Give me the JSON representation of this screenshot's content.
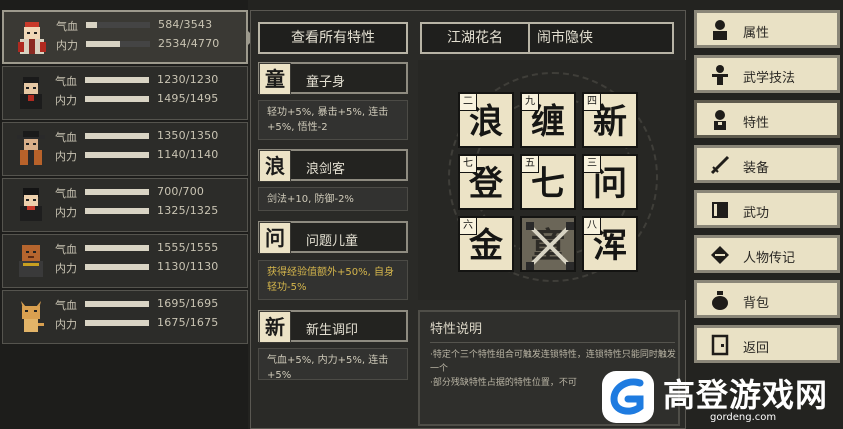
{
  "party": [
    {
      "hp_label": "气血",
      "mp_label": "内力",
      "hp": "584/3543",
      "mp": "2534/4770",
      "hp_frac": 0.165,
      "mp_frac": 0.531
    },
    {
      "hp_label": "气血",
      "mp_label": "内力",
      "hp": "1230/1230",
      "mp": "1495/1495",
      "hp_frac": 1.0,
      "mp_frac": 1.0
    },
    {
      "hp_label": "气血",
      "mp_label": "内力",
      "hp": "1350/1350",
      "mp": "1140/1140",
      "hp_frac": 1.0,
      "mp_frac": 1.0
    },
    {
      "hp_label": "气血",
      "mp_label": "内力",
      "hp": "700/700",
      "mp": "1325/1325",
      "hp_frac": 1.0,
      "mp_frac": 1.0
    },
    {
      "hp_label": "气血",
      "mp_label": "内力",
      "hp": "1555/1555",
      "mp": "1130/1130",
      "hp_frac": 1.0,
      "mp_frac": 1.0
    },
    {
      "hp_label": "气血",
      "mp_label": "内力",
      "hp": "1695/1695",
      "mp": "1675/1675",
      "hp_frac": 1.0,
      "mp_frac": 1.0
    }
  ],
  "header": {
    "view_all": "查看所有特性",
    "nickname_label": "江湖花名",
    "nickname_value": "闹市隐侠"
  },
  "traits": [
    {
      "icon": "童",
      "name": "童子身",
      "desc": "轻功+5%, 暴击+5%, 连击+5%, 悟性-2"
    },
    {
      "icon": "浪",
      "name": "浪剑客",
      "desc": "剑法+10, 防御-2%"
    },
    {
      "icon": "问",
      "name": "问题儿童",
      "desc": "获得经验值额外+50%, 自身轻功-5%"
    },
    {
      "icon": "新",
      "name": "新生调印",
      "desc": "气血+5%, 内力+5%, 连击+5%"
    }
  ],
  "grid": [
    {
      "num": "二",
      "char": "浪"
    },
    {
      "num": "九",
      "char": "缠"
    },
    {
      "num": "四",
      "char": "新"
    },
    {
      "num": "七",
      "char": "登"
    },
    {
      "num": "五",
      "char": "七"
    },
    {
      "num": "三",
      "char": "问"
    },
    {
      "num": "六",
      "char": "金"
    },
    {
      "num": "",
      "char": "童"
    },
    {
      "num": "八",
      "char": "浑"
    }
  ],
  "description": {
    "title": "特性说明",
    "text": "·特定个三个特性组合可触发连锁特性，连锁特性只能同时触发一个\n·部分残缺特性占据的特性位置，不可"
  },
  "menu": [
    {
      "icon": "person-icon",
      "label": "属性"
    },
    {
      "icon": "martial-icon",
      "label": "武学技法"
    },
    {
      "icon": "trait-icon",
      "label": "特性"
    },
    {
      "icon": "sword-icon",
      "label": "装备"
    },
    {
      "icon": "book-icon",
      "label": "武功"
    },
    {
      "icon": "biography-icon",
      "label": "人物传记"
    },
    {
      "icon": "bag-icon",
      "label": "背包"
    },
    {
      "icon": "return-icon",
      "label": "返回"
    }
  ],
  "watermark": {
    "title": "高登游戏网",
    "url": "gordeng.com"
  }
}
